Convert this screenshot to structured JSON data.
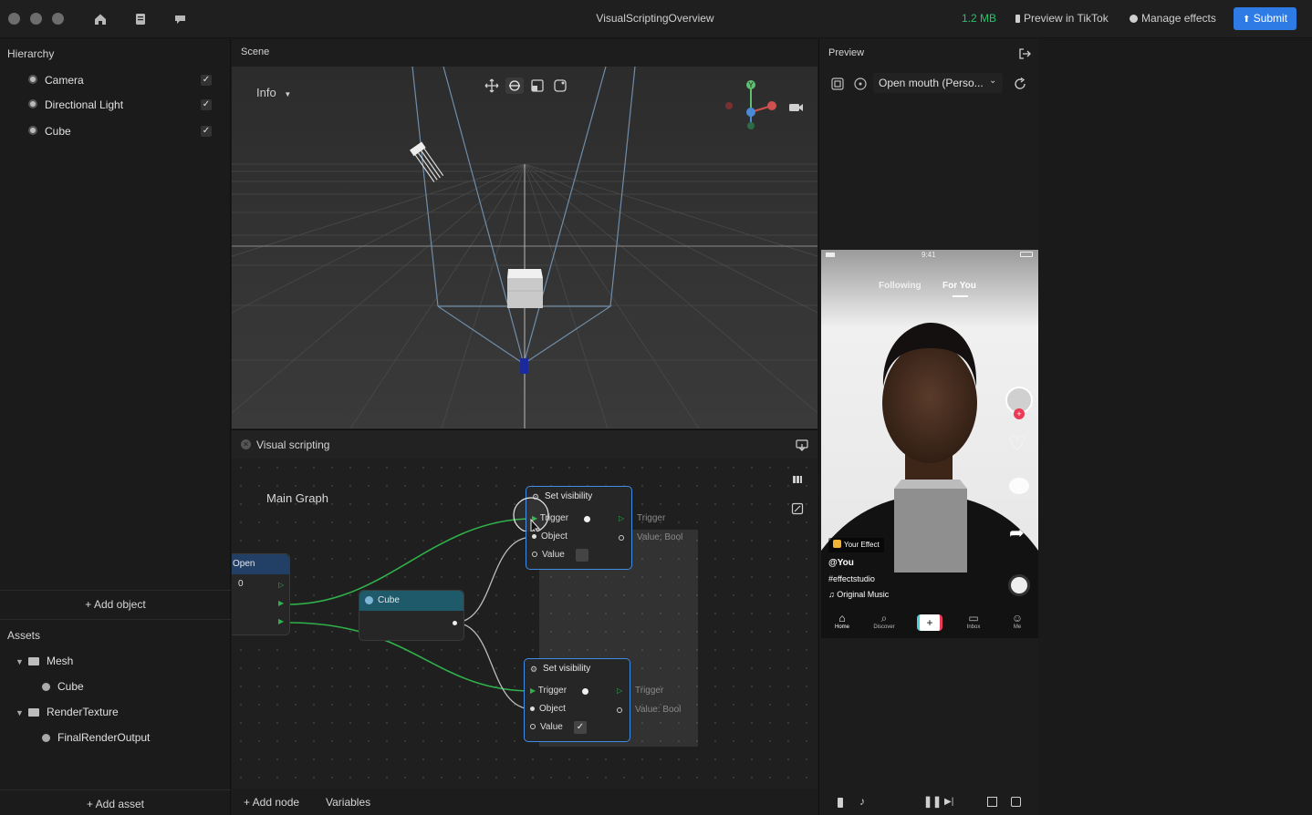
{
  "app": {
    "title": "VisualScriptingOverview",
    "file_size": "1.2 MB",
    "preview_in_tiktok": "Preview in TikTok",
    "manage_effects": "Manage effects",
    "submit": "Submit"
  },
  "hierarchy": {
    "title": "Hierarchy",
    "items": [
      {
        "label": "Camera",
        "checked": true
      },
      {
        "label": "Directional Light",
        "checked": true
      },
      {
        "label": "Cube",
        "checked": true
      }
    ],
    "add_object": "+ Add object"
  },
  "assets": {
    "title": "Assets",
    "tree": [
      {
        "label": "Mesh",
        "children": [
          "Cube"
        ]
      },
      {
        "label": "RenderTexture",
        "children": [
          "FinalRenderOutput"
        ]
      }
    ],
    "add_asset": "+ Add asset"
  },
  "scene": {
    "title": "Scene",
    "info_dropdown": "Info",
    "gizmo_y": "Y"
  },
  "visual_scripting": {
    "title": "Visual scripting",
    "graph_name": "Main Graph",
    "add_node": "+ Add node",
    "variables": "Variables",
    "nodes": {
      "open": {
        "title": "Open",
        "value": "0"
      },
      "cube": {
        "title": "Cube"
      },
      "set_visibility_1": {
        "title": "Set visibility",
        "ports": [
          "Trigger",
          "Object",
          "Value"
        ],
        "out_trigger": "Trigger",
        "out_value": "Value: Bool"
      },
      "set_visibility_2": {
        "title": "Set visibility",
        "ports": [
          "Trigger",
          "Object",
          "Value"
        ],
        "out_trigger": "Trigger",
        "out_value": "Value: Bool"
      }
    }
  },
  "preview": {
    "title": "Preview",
    "effect_select": "Open mouth (Perso...",
    "phone": {
      "time": "9:41",
      "tab_following": "Following",
      "tab_for_you": "For You",
      "effect_tag": "Your Effect",
      "username": "@You",
      "hashtag": "#effectstudio",
      "music": "Original Music",
      "nav": [
        "Home",
        "Discover",
        "Inbox",
        "Me"
      ]
    }
  },
  "colors": {
    "accent": "#2f7be6",
    "file_size": "#26c26b",
    "wire": "#2fb14a",
    "cube_node_header": "#1f5a6b",
    "open_node_header": "#223f66"
  }
}
